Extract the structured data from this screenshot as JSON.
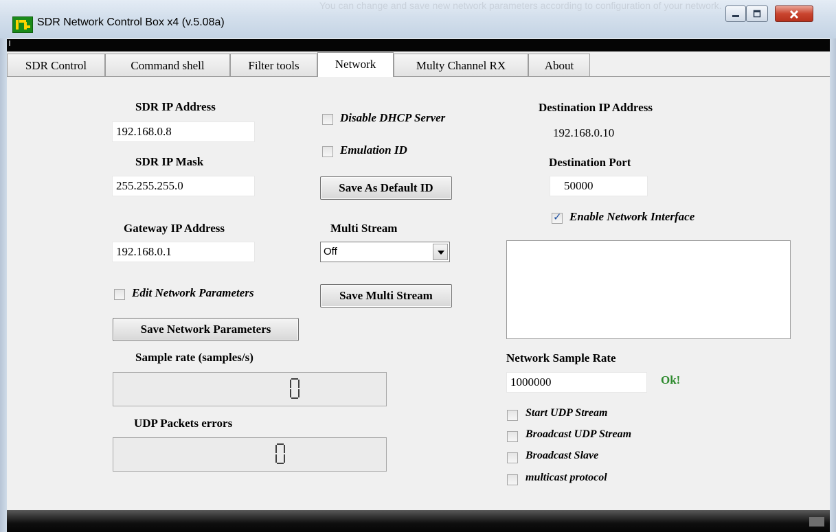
{
  "window": {
    "title": "SDR Network Control Box x4 (v.5.08a)",
    "ghost_text": "You can change and save new network parameters according to configuration of your network."
  },
  "tabs": [
    {
      "label": "SDR Control"
    },
    {
      "label": "Command shell"
    },
    {
      "label": "Filter tools"
    },
    {
      "label": "Network",
      "active": true
    },
    {
      "label": "Multy Channel RX"
    },
    {
      "label": "About"
    }
  ],
  "network": {
    "sdr_ip_label": "SDR IP Address",
    "sdr_ip_value": "192.168.0.8",
    "sdr_mask_label": "SDR IP Mask",
    "sdr_mask_value": "255.255.255.0",
    "gateway_label": "Gateway IP Address",
    "gateway_value": "192.168.0.1",
    "edit_params_label": "Edit Network Parameters",
    "edit_params_checked": false,
    "save_params_button": "Save Network Parameters",
    "sample_rate_label": "Sample rate (samples/s)",
    "sample_rate_value": "0",
    "udp_errors_label": "UDP Packets errors",
    "udp_errors_value": "0",
    "disable_dhcp_label": "Disable DHCP Server",
    "disable_dhcp_checked": false,
    "emulation_id_label": "Emulation ID",
    "emulation_id_checked": false,
    "save_default_id_button": "Save As Default ID",
    "multi_stream_label": "Multi Stream",
    "multi_stream_value": "Off",
    "save_multi_stream_button": "Save Multi Stream",
    "dest_ip_label": "Destination IP Address",
    "dest_ip_value": "192.168.0.10",
    "dest_port_label": "Destination Port",
    "dest_port_value": "50000",
    "enable_interface_label": "Enable Network Interface",
    "enable_interface_checked": true,
    "net_sample_rate_label": "Network Sample Rate",
    "net_sample_rate_value": "1000000",
    "net_sample_rate_status": "Ok!",
    "options": [
      {
        "label": "Start UDP Stream",
        "checked": false
      },
      {
        "label": "Broadcast UDP Stream",
        "checked": false
      },
      {
        "label": "Broadcast Slave",
        "checked": false
      },
      {
        "label": "multicast protocol",
        "checked": false
      }
    ]
  },
  "colors": {
    "status_ok": "#2d8a2d",
    "checkmark": "#1d4fa0",
    "close_button": "#c9452f"
  }
}
